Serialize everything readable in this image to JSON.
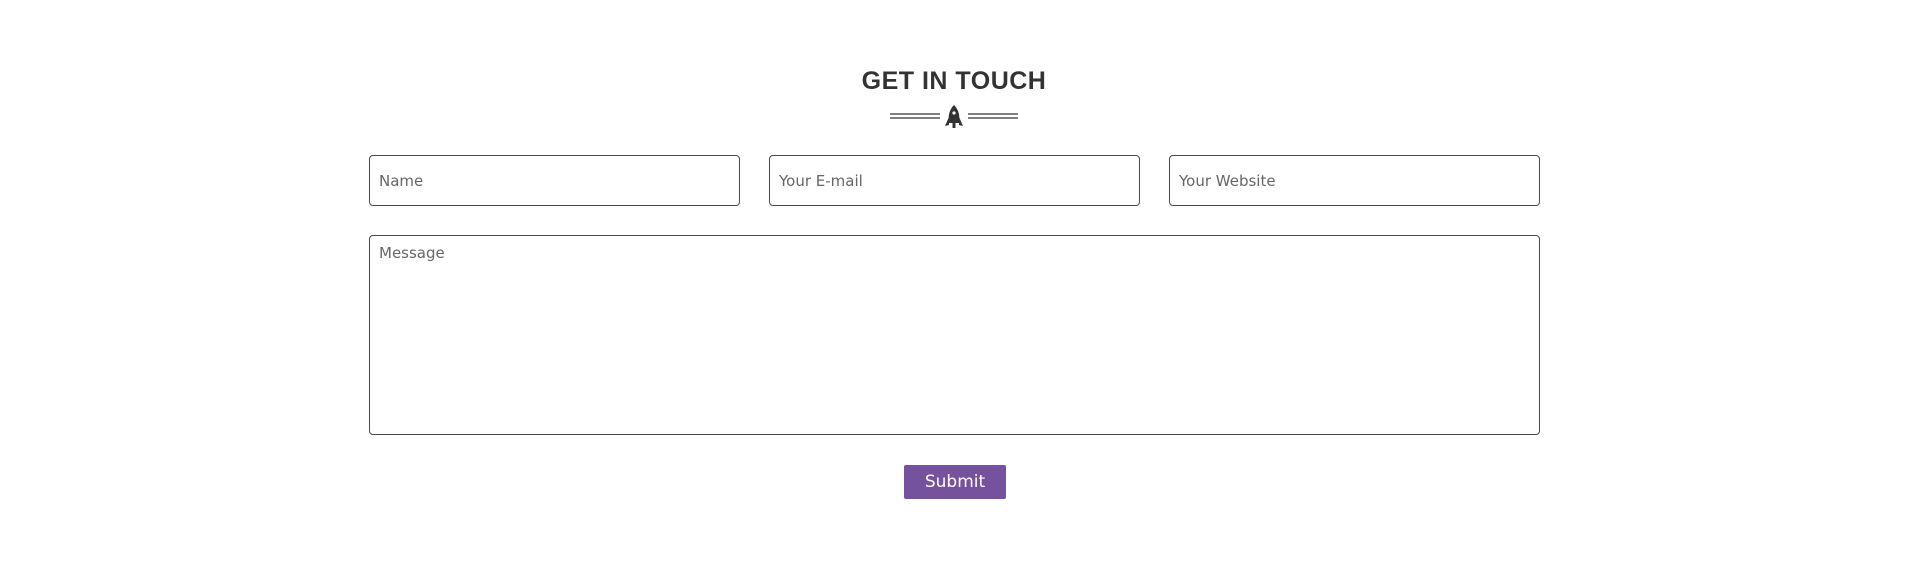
{
  "contact_section": {
    "title": "GET IN TOUCH",
    "divider_icon": "rocket-icon",
    "fields": {
      "name_placeholder": "Name",
      "email_placeholder": "Your E-mail",
      "website_placeholder": "Your Website",
      "message_placeholder": "Message"
    },
    "submit_label": "Submit"
  },
  "colors": {
    "heading": "#333333",
    "border": "#4a4a4a",
    "placeholder": "#666666",
    "submit_bg": "#76519e",
    "submit_text": "#ffffff"
  }
}
